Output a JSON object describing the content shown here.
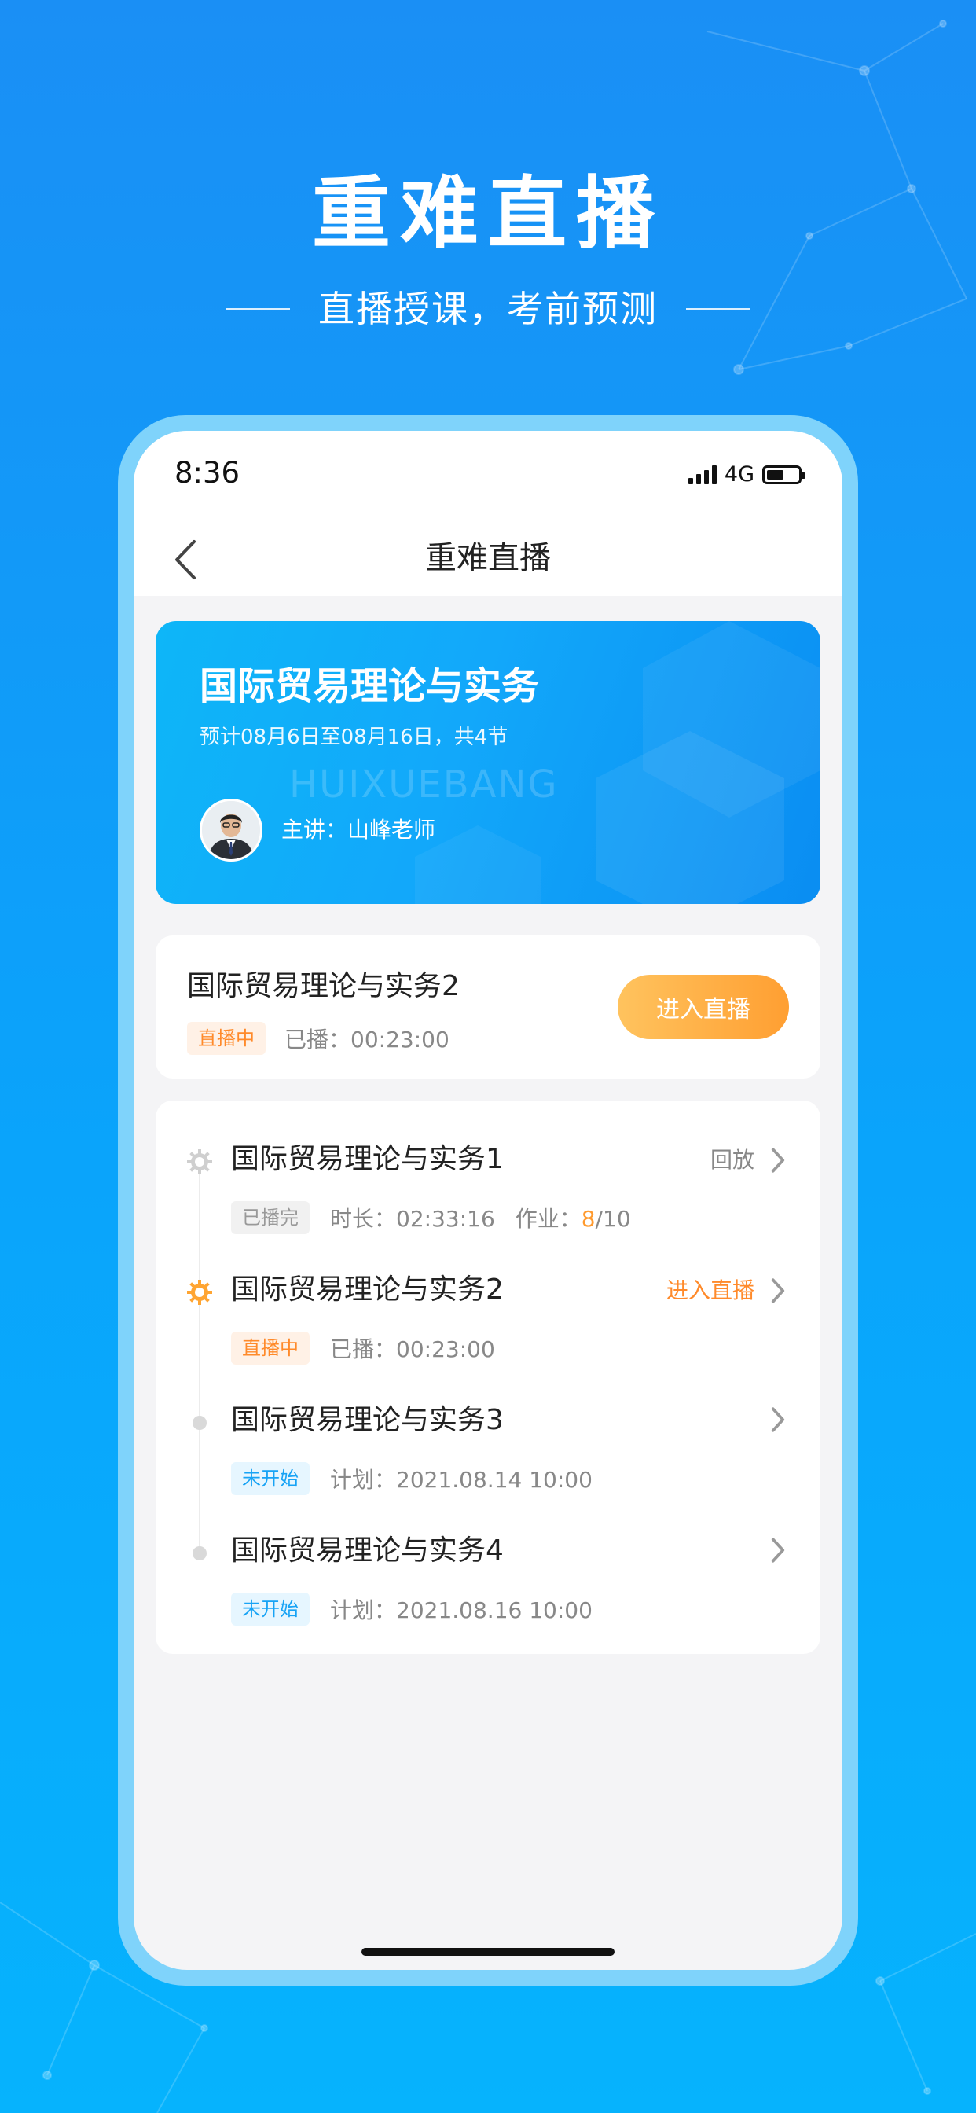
{
  "promo": {
    "title": "重难直播",
    "subtitle": "直播授课，考前预测"
  },
  "status_bar": {
    "time": "8:36",
    "network": "4G",
    "battery_level": 0.55
  },
  "nav": {
    "title": "重难直播",
    "back_icon": "chevron-left-icon"
  },
  "course": {
    "title": "国际贸易理论与实务",
    "schedule": "预计08月6日至08月16日，共4节",
    "watermark": "HUIXUEBANG",
    "lecturer": "主讲：山峰老师"
  },
  "live_now": {
    "title": "国际贸易理论与实务2",
    "status_tag": "直播中",
    "played": "已播：00:23:00",
    "enter_label": "进入直播"
  },
  "lessons": [
    {
      "title": "国际贸易理论与实务1",
      "tag": "已播完",
      "meta": "时长：02:33:16",
      "homework_prefix": "作业：",
      "homework_done": "8",
      "homework_total": "/10",
      "action": "回放"
    },
    {
      "title": "国际贸易理论与实务2",
      "tag": "直播中",
      "meta": "已播：00:23:00",
      "action": "进入直播"
    },
    {
      "title": "国际贸易理论与实务3",
      "tag": "未开始",
      "meta": "计划：2021.08.14  10:00",
      "action": ""
    },
    {
      "title": "国际贸易理论与实务4",
      "tag": "未开始",
      "meta": "计划：2021.08.16  10:00",
      "action": ""
    }
  ],
  "colors": {
    "accent_blue": "#0aa4fb",
    "accent_orange": "#ff8a2a"
  }
}
